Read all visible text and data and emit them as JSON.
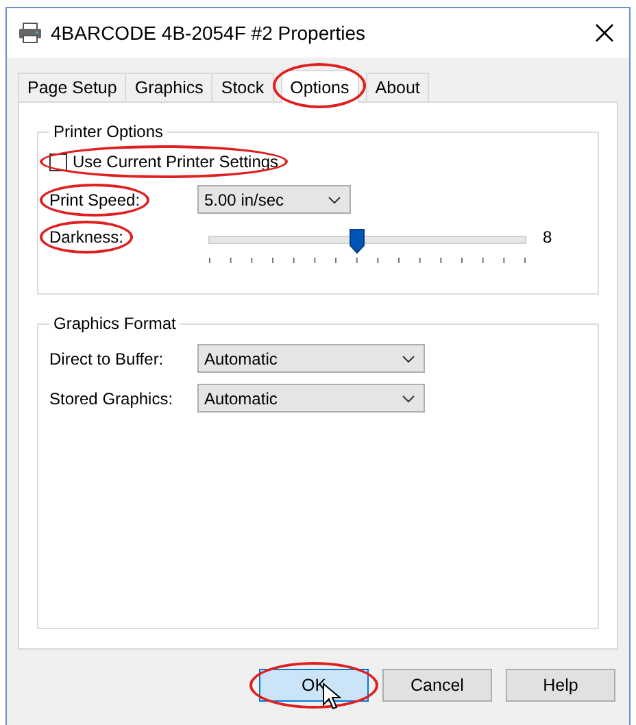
{
  "window": {
    "title": "4BARCODE 4B-2054F #2 Properties"
  },
  "tabs": [
    {
      "label": "Page Setup",
      "selected": false,
      "circled": false
    },
    {
      "label": "Graphics",
      "selected": false,
      "circled": false
    },
    {
      "label": "Stock",
      "selected": false,
      "circled": false
    },
    {
      "label": "Options",
      "selected": true,
      "circled": true
    },
    {
      "label": "About",
      "selected": false,
      "circled": false
    }
  ],
  "printer_options": {
    "title": "Printer Options",
    "use_current_settings": {
      "label": "Use Current Printer Settings",
      "checked": false,
      "circled": true
    },
    "print_speed": {
      "label": "Print Speed:",
      "value": "5.00 in/sec",
      "circled": true
    },
    "darkness": {
      "label": "Darkness:",
      "level": 0.47,
      "reading": "8",
      "circled": true
    }
  },
  "graphics_format": {
    "title": "Graphics Format",
    "fields": [
      {
        "label": "Direct to Buffer:",
        "value": "Automatic"
      },
      {
        "label": "Stored Graphics:",
        "value": "Automatic"
      }
    ]
  },
  "buttons": [
    {
      "label": "OK",
      "focused": true,
      "circled": true
    },
    {
      "label": "Cancel",
      "focused": false,
      "circled": false
    },
    {
      "label": "Help",
      "focused": false,
      "circled": false
    }
  ]
}
